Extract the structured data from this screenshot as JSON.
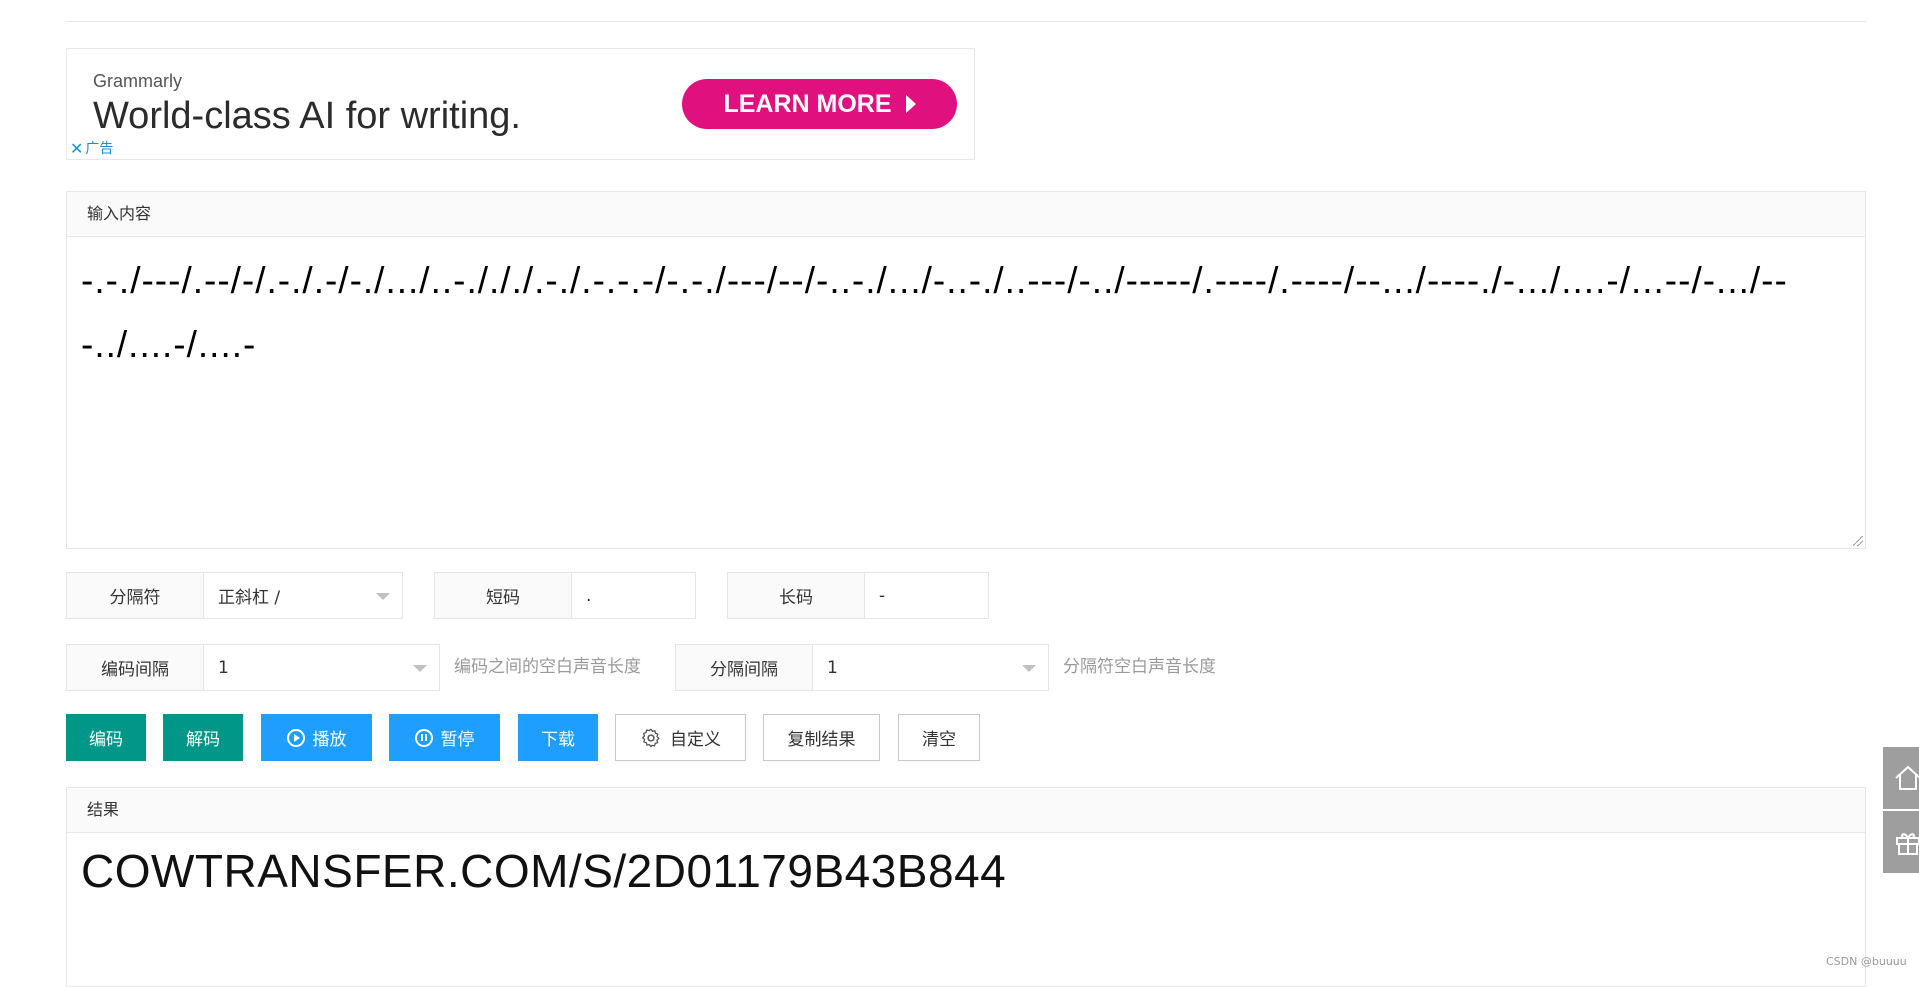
{
  "ad": {
    "brand": "Grammarly",
    "headline": "World-class AI for writing.",
    "cta_label": "LEARN MORE",
    "close_glyph": "✕",
    "ad_label": "广告"
  },
  "input_panel": {
    "title": "输入内容",
    "value": "-.-./---/.--/-/.-./.-/-./.../..-./././.-./.-.-.-/-.-./---/--/-..-./.../-..-./..---/-../-----/.----/.----/--.../----./-.../....-/...--/-.../---../....-/....-"
  },
  "options": {
    "separator": {
      "label": "分隔符",
      "value": "正斜杠 /"
    },
    "short_code": {
      "label": "短码",
      "value": "."
    },
    "long_code": {
      "label": "长码",
      "value": "-"
    },
    "code_interval": {
      "label": "编码间隔",
      "value": "1",
      "hint": "编码之间的空白声音长度"
    },
    "separator_interval": {
      "label": "分隔间隔",
      "value": "1",
      "hint": "分隔符空白声音长度"
    }
  },
  "buttons": {
    "encode": "编码",
    "decode": "解码",
    "play": "播放",
    "pause": "暂停",
    "download": "下载",
    "customize": "自定义",
    "copy_result": "复制结果",
    "clear": "清空"
  },
  "result_panel": {
    "title": "结果",
    "value": "COWTRANSFER.COM/S/2D01179B43B844"
  },
  "icons": {
    "home": "home-icon",
    "gift": "gift-icon"
  },
  "watermark": "CSDN @buuuu",
  "colors": {
    "green": "#009688",
    "blue": "#1e9fff",
    "ad_pink": "#e0117f"
  }
}
